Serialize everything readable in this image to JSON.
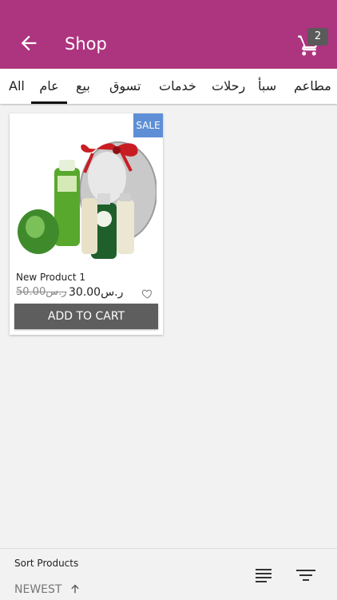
{
  "appbar": {
    "title": "Shop",
    "cart_count": "2"
  },
  "tabs": [
    "All",
    "عام",
    "بيع",
    "تسوق",
    "خدمات",
    "رحلات",
    "سبأ",
    "مطاعم"
  ],
  "active_tab": "عام",
  "product": {
    "name": "New Product 1",
    "sale_badge": "SALE",
    "old_price": "50.00ر.س",
    "price": "ر.س30.00",
    "add_to_cart": "ADD TO CART"
  },
  "sort": {
    "label": "Sort Products",
    "value": "NEWEST"
  },
  "colors": {
    "appbar": "#ad347f",
    "sale": "#5e8fd6",
    "button": "#5e5e5e",
    "background": "#f2f2f2"
  },
  "icons": [
    "back-arrow-icon",
    "cart-icon",
    "heart-icon",
    "up-arrow-icon",
    "align-icon",
    "filter-icon"
  ]
}
